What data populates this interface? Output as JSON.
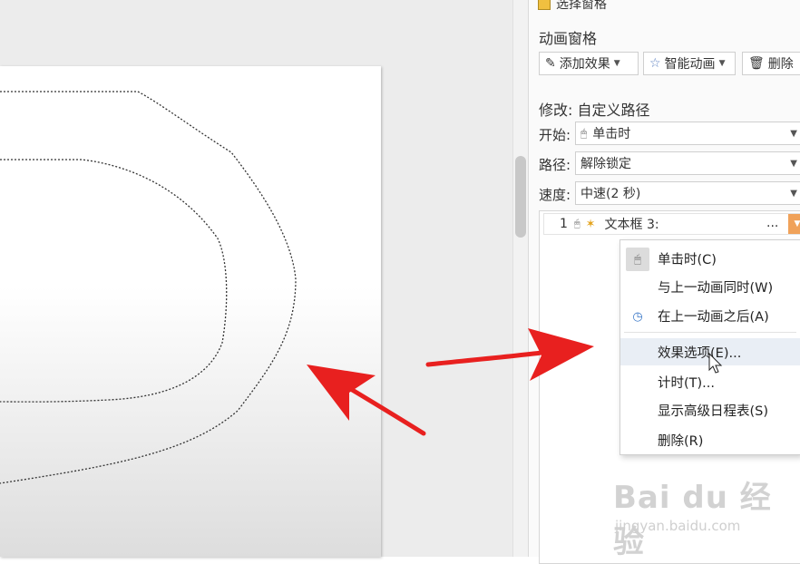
{
  "pane_link": "选择窗格",
  "panel": {
    "title": "动画窗格",
    "toolbar": {
      "add_effect": "添加效果",
      "smart_animation": "智能动画",
      "delete": "删除"
    },
    "modify_label": "修改: 自定义路径",
    "start": {
      "label": "开始:",
      "value": "单击时"
    },
    "path": {
      "label": "路径:",
      "value": "解除锁定"
    },
    "speed": {
      "label": "速度:",
      "value": "中速(2 秒)"
    },
    "list": [
      {
        "number": "1",
        "label": "文本框 3:",
        "more": "..."
      }
    ]
  },
  "context_menu": [
    {
      "label": "单击时(C)",
      "icon": "mouse-icon"
    },
    {
      "label": "与上一动画同时(W)",
      "icon": ""
    },
    {
      "label": "在上一动画之后(A)",
      "icon": "clock-icon"
    },
    {
      "label": "效果选项(E)...",
      "icon": ""
    },
    {
      "label": "计时(T)...",
      "icon": ""
    },
    {
      "label": "显示高级日程表(S)",
      "icon": ""
    },
    {
      "label": "删除(R)",
      "icon": ""
    }
  ],
  "watermark": {
    "brand": "Bai du 经验",
    "site": "jingyan.baidu.com"
  },
  "colors": {
    "arrow_red": "#e8201f",
    "dropdown_orange": "#f0a25a",
    "menu_hover": "#e9eef5"
  }
}
